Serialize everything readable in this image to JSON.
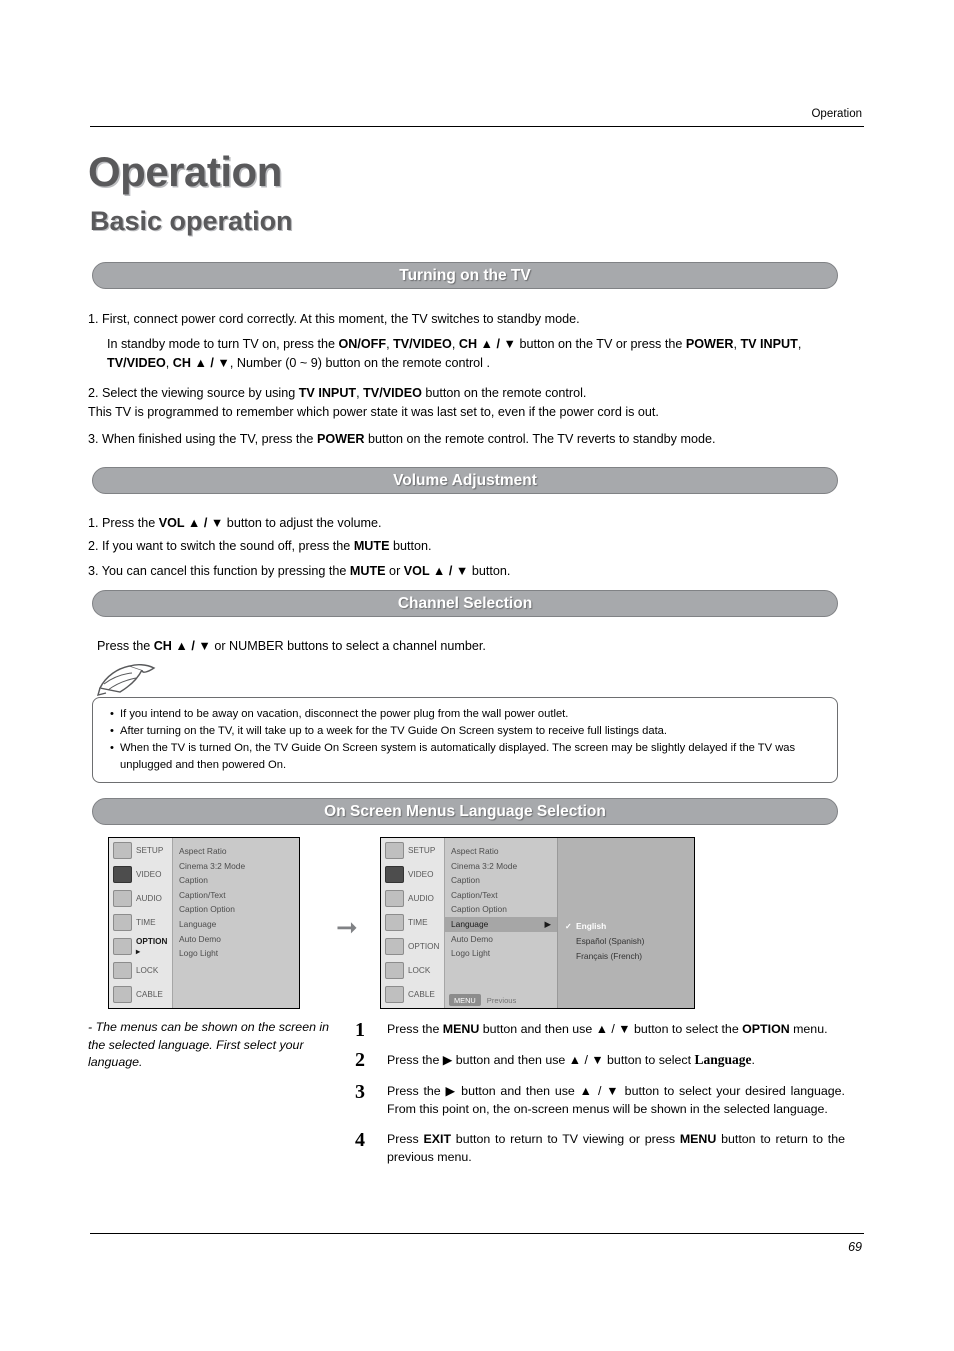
{
  "header": {
    "running_head": "Operation",
    "page_number": "69"
  },
  "title": "Operation",
  "subtitle": "Basic operation",
  "sections": {
    "turning_on": {
      "banner": "Turning on the TV",
      "items": [
        {
          "num": "1.",
          "html": "First, connect power cord correctly. At this moment, the TV switches to standby mode."
        },
        {
          "html2": "In standby mode to turn TV on, press the <b>ON/OFF</b>, <b>TV/VIDEO</b>, <b>CH ▲ / ▼</b> button on the TV or press the <b>POWER</b>, <b>TV INPUT</b>, <b>TV/VIDEO</b>, <b>CH ▲ / ▼</b>, Number (0 ~ 9) button on the remote control ."
        },
        {
          "num": "2.",
          "html": "Select the viewing source by using <b>TV INPUT</b>, <b>TV/VIDEO</b> button on the remote control.<br>This TV is programmed to remember which power state it was last set to, even if the power cord is out."
        },
        {
          "num": "3.",
          "html": "When finished using the TV, press the <b>POWER</b> button on the remote control. The TV reverts to  standby mode."
        }
      ]
    },
    "volume": {
      "banner": "Volume Adjustment",
      "items": [
        {
          "num": "1.",
          "html": "Press the <b>VOL ▲ / ▼</b> button to adjust the volume."
        },
        {
          "num": "2.",
          "html": "If you want to switch the sound off, press the <b>MUTE</b> button."
        },
        {
          "num": "3.",
          "html": "You can cancel this function by pressing the <b>MUTE</b> or <b>VOL ▲ / ▼</b> button."
        }
      ]
    },
    "channel": {
      "banner": "Channel Selection",
      "text_html": "Press the <b>CH ▲ / ▼</b> or NUMBER buttons to select a channel number."
    },
    "note": {
      "bullets": [
        "If you intend to be away on vacation, disconnect the power plug from the wall power outlet.",
        "After turning on the TV, it will take up to a week for the TV Guide On Screen system to receive full listings data.",
        "When the TV is turned On, the TV Guide On Screen system is automatically displayed. The screen may be slightly delayed if the TV was unplugged and then powered On."
      ]
    },
    "language": {
      "banner": "On Screen Menus Language Selection",
      "caption": "-  The menus can be shown on the screen in the selected language. First select your language.",
      "steps": [
        {
          "num": "1",
          "html": "Press the <b>MENU</b> button and then use ▲ / ▼ button to select the <b>OPTION</b> menu."
        },
        {
          "num": "2",
          "html": "Press the ▶ button and then use ▲ / ▼ button to select <span class=\"lang-word\">Language</span>."
        },
        {
          "num": "3",
          "html": "Press the ▶ button and then use ▲ / ▼ button to select your desired language. From this point on, the on-screen menus will be shown in the selected language."
        },
        {
          "num": "4",
          "html": "Press <b>EXIT</b> button to return to TV viewing or press <b>MENU</b> button to return to the previous menu."
        }
      ],
      "osd_left": {
        "menu": [
          {
            "label": "SETUP",
            "selected": false
          },
          {
            "label": "VIDEO",
            "selected": false
          },
          {
            "label": "AUDIO",
            "selected": false
          },
          {
            "label": "TIME",
            "selected": false
          },
          {
            "label": "OPTION ▸",
            "selected": true
          },
          {
            "label": "LOCK",
            "selected": false
          },
          {
            "label": "CABLE",
            "selected": false
          }
        ],
        "options": [
          "Aspect Ratio",
          "Cinema 3:2 Mode",
          "Caption",
          "Caption/Text",
          "Caption Option",
          "Language",
          "Auto Demo",
          "Logo Light"
        ]
      },
      "osd_right": {
        "menu": [
          {
            "label": "SETUP",
            "selected": false
          },
          {
            "label": "VIDEO",
            "selected": false
          },
          {
            "label": "AUDIO",
            "selected": false
          },
          {
            "label": "TIME",
            "selected": false
          },
          {
            "label": "OPTION",
            "selected": false
          },
          {
            "label": "LOCK",
            "selected": false
          },
          {
            "label": "CABLE",
            "selected": false
          }
        ],
        "options": [
          {
            "label": "Aspect Ratio",
            "highlighted": false
          },
          {
            "label": "Cinema 3:2 Mode",
            "highlighted": false
          },
          {
            "label": "Caption",
            "highlighted": false
          },
          {
            "label": "Caption/Text",
            "highlighted": false
          },
          {
            "label": "Caption Option",
            "highlighted": false
          },
          {
            "label": "Language",
            "highlighted": true,
            "arrow": "▶"
          },
          {
            "label": "Auto Demo",
            "highlighted": false
          },
          {
            "label": "Logo Light",
            "highlighted": false
          }
        ],
        "languages": [
          {
            "label": "English",
            "checked": true
          },
          {
            "label": "Español (Spanish)",
            "checked": false
          },
          {
            "label": "Français (French)",
            "checked": false
          }
        ],
        "menu_key": "MENU",
        "previous_label": "Previous"
      }
    }
  }
}
